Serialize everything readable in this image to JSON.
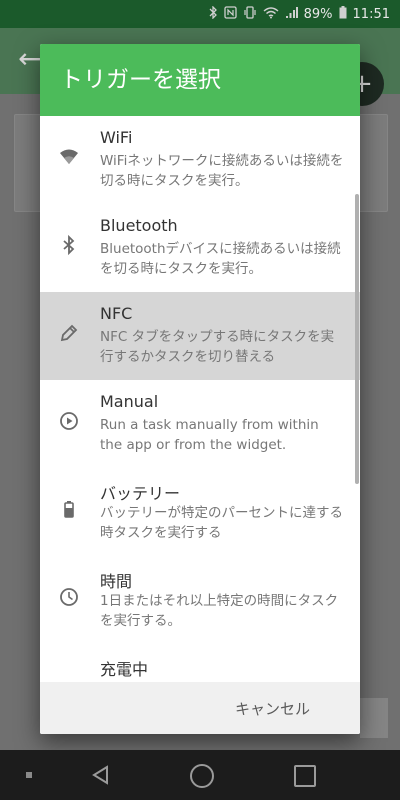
{
  "status_bar": {
    "battery": "89%",
    "time": "11:51",
    "icons": [
      "bluetooth-icon",
      "nfc-icon",
      "vibrate-icon",
      "wifi-icon",
      "signal-icon",
      "battery-icon"
    ]
  },
  "dialog": {
    "title": "トリガーを選択",
    "items": [
      {
        "title": "WiFi",
        "desc": "WiFiネットワークに接続あるいは接続を切る時にタスクを実行。",
        "icon": "wifi-icon"
      },
      {
        "title": "Bluetooth",
        "desc": "Bluetoothデバイスに接続あるいは接続を切る時にタスクを実行。",
        "icon": "bluetooth-icon"
      },
      {
        "title": "NFC",
        "desc": "NFC タブをタップする時にタスクを実行するかタスクを切り替える",
        "icon": "nfc-tag-icon",
        "selected": true
      },
      {
        "title": "Manual",
        "desc": "Run a task manually from within the app or from the widget.",
        "icon": "play-circle-icon"
      },
      {
        "title": "バッテリー",
        "desc": "バッテリーが特定のパーセントに達する時タスクを実行する",
        "icon": "battery-icon"
      },
      {
        "title": "時間",
        "desc": "1日またはそれ以上特定の時間にタスクを実行する。",
        "icon": "clock-icon"
      },
      {
        "title": "充電中",
        "desc": "",
        "icon": "charging-icon"
      }
    ],
    "cancel_label": "キャンセル"
  },
  "colors": {
    "header": "#4cbb5a",
    "selected_row": "#d6d6d6"
  }
}
